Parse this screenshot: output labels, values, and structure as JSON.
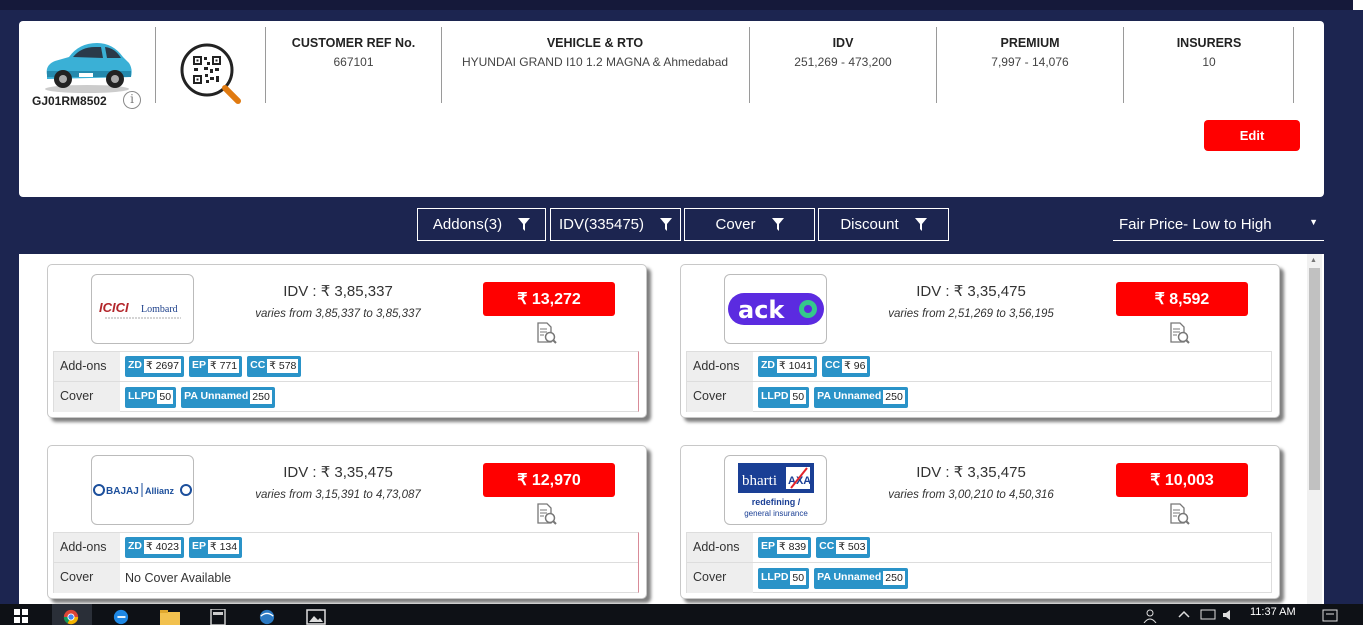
{
  "vehicle": {
    "registration": "GJ01RM8502"
  },
  "summary": {
    "customer_ref": {
      "label": "CUSTOMER REF No.",
      "value": "667101"
    },
    "vehicle_rto": {
      "label": "VEHICLE & RTO",
      "value": "HYUNDAI GRAND I10 1.2 MAGNA & Ahmedabad"
    },
    "idv": {
      "label": "IDV",
      "value": "251,269 - 473,200"
    },
    "premium": {
      "label": "PREMIUM",
      "value": "7,997 - 14,076"
    },
    "insurers": {
      "label": "INSURERS",
      "value": "10"
    },
    "edit_label": "Edit"
  },
  "filters": [
    {
      "label": "Addons(3)"
    },
    {
      "label": "IDV(335475)"
    },
    {
      "label": "Cover"
    },
    {
      "label": "Discount"
    }
  ],
  "sort": {
    "selected": "Fair Price- Low to High"
  },
  "labels": {
    "addons": "Add-ons",
    "cover": "Cover"
  },
  "quotes": [
    {
      "insurer": "ICICI Lombard",
      "logo_text": {
        "a": "ICICI",
        "b": "Lombard"
      },
      "idv": "IDV : ₹ 3,85,337",
      "varies": "varies from 3,85,337 to 3,85,337",
      "price": "₹ 13,272",
      "addons": [
        {
          "code": "ZD",
          "amount": "₹ 2697"
        },
        {
          "code": "EP",
          "amount": "₹ 771"
        },
        {
          "code": "CC",
          "amount": "₹ 578"
        }
      ],
      "cover": [
        {
          "code": "LLPD",
          "amount": "50"
        },
        {
          "code": "PA Unnamed",
          "amount": "250"
        }
      ],
      "cover_text": ""
    },
    {
      "insurer": "Acko",
      "logo_text": {
        "a": "acko"
      },
      "idv": "IDV : ₹ 3,35,475",
      "varies": "varies from 2,51,269 to 3,56,195",
      "price": "₹ 8,592",
      "addons": [
        {
          "code": "ZD",
          "amount": "₹ 1041"
        },
        {
          "code": "CC",
          "amount": "₹ 96"
        }
      ],
      "cover": [
        {
          "code": "LLPD",
          "amount": "50"
        },
        {
          "code": "PA Unnamed",
          "amount": "250"
        }
      ],
      "cover_text": ""
    },
    {
      "insurer": "Bajaj Allianz",
      "logo_text": {
        "a": "BAJAJ",
        "b": "Allianz"
      },
      "idv": "IDV : ₹ 3,35,475",
      "varies": "varies from 3,15,391 to 4,73,087",
      "price": "₹ 12,970",
      "addons": [
        {
          "code": "ZD",
          "amount": "₹ 4023"
        },
        {
          "code": "EP",
          "amount": "₹ 134"
        }
      ],
      "cover": [],
      "cover_text": "No Cover Available"
    },
    {
      "insurer": "Bharti AXA",
      "logo_text": {
        "a": "bharti",
        "b": "AXA",
        "c": "redefining /",
        "d": "general insurance"
      },
      "idv": "IDV : ₹ 3,35,475",
      "varies": "varies from 3,00,210 to 4,50,316",
      "price": "₹ 10,003",
      "addons": [
        {
          "code": "EP",
          "amount": "₹ 839"
        },
        {
          "code": "CC",
          "amount": "₹ 503"
        }
      ],
      "cover": [
        {
          "code": "LLPD",
          "amount": "50"
        },
        {
          "code": "PA Unnamed",
          "amount": "250"
        }
      ],
      "cover_text": ""
    }
  ],
  "taskbar": {
    "time": "11:37 AM"
  },
  "colors": {
    "navy": "#1c2550",
    "price_red": "#ff0000",
    "chip_blue": "#2a93c8"
  }
}
